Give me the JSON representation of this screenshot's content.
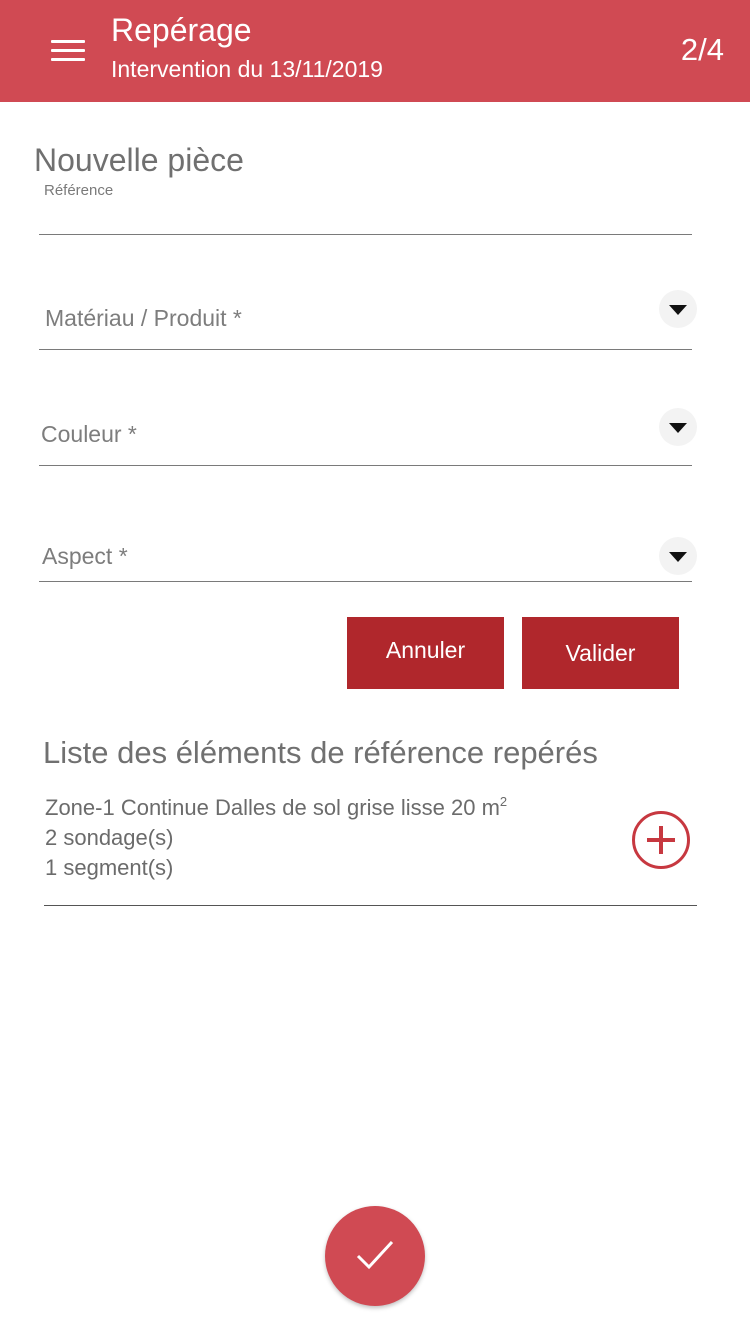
{
  "header": {
    "title": "Repérage",
    "subtitle": "Intervention du 13/11/2019",
    "step": "2/4",
    "menu_icon": "hamburger-menu-icon",
    "background_color": "#d04a53"
  },
  "form": {
    "title": "Nouvelle pièce",
    "reference": {
      "label": "Référence",
      "value": ""
    },
    "materiau": {
      "placeholder": "Matériau / Produit *",
      "value": ""
    },
    "couleur": {
      "placeholder": "Couleur *",
      "value": ""
    },
    "aspect": {
      "placeholder": "Aspect *",
      "value": ""
    },
    "dropdown_icon": "triangle-down-icon",
    "cancel_label": "Annuler",
    "submit_label": "Valider",
    "button_color": "#b0272c"
  },
  "list": {
    "title": "Liste des éléments de référence repérés",
    "items": [
      {
        "line1": "Zone-1 Continue Dalles de sol grise lisse 20 m",
        "line1_sup": "2",
        "line2": "2 sondage(s)",
        "line3": "1 segment(s)",
        "action_icon": "add-circle-icon"
      }
    ]
  },
  "fab": {
    "icon": "check-icon"
  }
}
